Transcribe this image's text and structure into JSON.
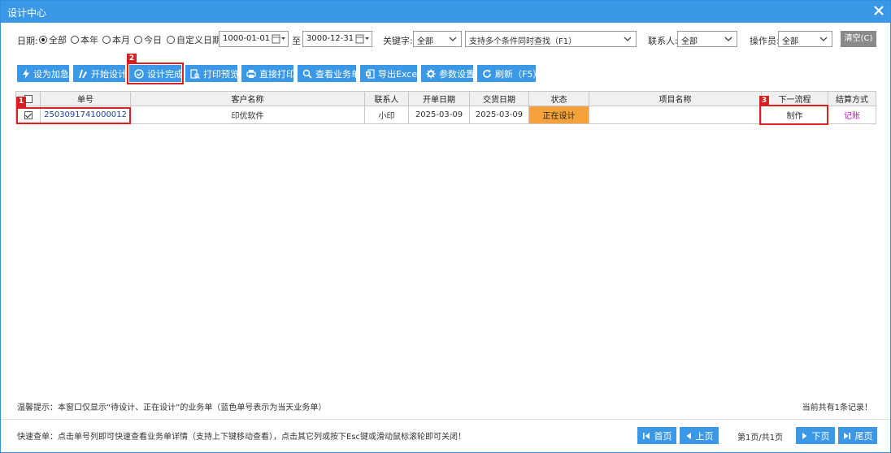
{
  "window": {
    "title": "设计中心"
  },
  "filters": {
    "date_label": "日期:",
    "date_options": [
      "全部",
      "本年",
      "本月",
      "今日",
      "自定义日期"
    ],
    "date_selected": "全部",
    "date_from": "1000-01-01",
    "date_to_label": "至",
    "date_to": "3000-12-31",
    "keyword_label": "关键字:",
    "keyword_select": "全部",
    "keyword_placeholder": "支持多个条件同时查找（F1）",
    "contact_label": "联系人:",
    "contact_select": "全部",
    "operator_label": "操作员:",
    "operator_select": "全部",
    "clear_button": "清空(C)"
  },
  "toolbar": {
    "buttons": [
      {
        "label": "设为加急",
        "icon": "lightning-icon"
      },
      {
        "label": "开始设计",
        "icon": "design-icon"
      },
      {
        "label": "设计完成",
        "icon": "check-circle-icon"
      },
      {
        "label": "打印预览",
        "icon": "print-preview-icon"
      },
      {
        "label": "直接打印",
        "icon": "printer-icon"
      },
      {
        "label": "查看业务单",
        "icon": "search-icon"
      },
      {
        "label": "导出Excel",
        "icon": "excel-icon"
      },
      {
        "label": "参数设置",
        "icon": "gear-icon"
      },
      {
        "label": "刷新（F5）",
        "icon": "refresh-icon"
      }
    ]
  },
  "annotations": {
    "badge1": "1",
    "badge2": "2",
    "badge3": "3"
  },
  "table": {
    "columns": [
      "单号",
      "客户名称",
      "联系人",
      "开单日期",
      "交货日期",
      "状态",
      "项目名称",
      "下一流程",
      "结算方式"
    ],
    "rows": [
      {
        "checked": true,
        "order_no": "2503091741000012",
        "customer": "印优软件",
        "contact": "小印",
        "open_date": "2025-03-09",
        "delivery_date": "2025-03-09",
        "status": "正在设计",
        "project": "",
        "next_step": "制作",
        "settlement": "记账"
      }
    ]
  },
  "footer": {
    "tip": "温馨提示：本窗口仅显示“待设计、正在设计”的业务单（蓝色单号表示为当天业务单）",
    "record_count": "当前共有1条记录！",
    "quick_view": "快速查单：点击单号列即可快速查看业务单详情（支持上下键移动查看），点击其它列或按下Esc键或滑动鼠标滚轮即可关闭！",
    "first_page": "首页",
    "prev_page": "上页",
    "page_info": "第1页/共1页",
    "next_page": "下页",
    "last_page": "尾页"
  },
  "colors": {
    "accent": "#3a98e6",
    "status_bg": "#f6a23a",
    "annotation_red": "#e02020",
    "order_no": "#1f3fa0",
    "settlement": "#c020c0"
  }
}
